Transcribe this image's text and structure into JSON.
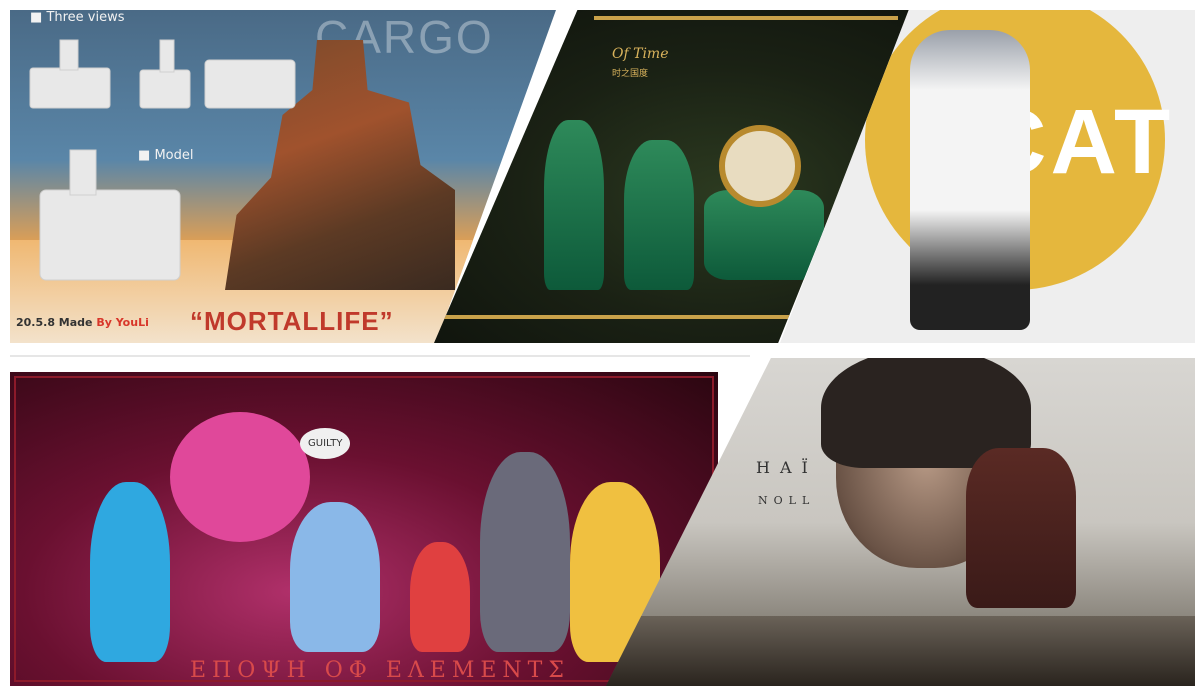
{
  "panels": {
    "mortal_life": {
      "label_three_views": "Three views",
      "label_model": "Model",
      "watermark": "CARGO",
      "made_prefix": "20.5.8 Made ",
      "made_by": "By YouLi",
      "title": "“MORTALLIFE”"
    },
    "of_time": {
      "title": "Of Time",
      "subtitle": "时之国度"
    },
    "cat": {
      "title": "CAT"
    },
    "elements": {
      "bubble": "GUILTY",
      "title": "ΕΠΟΨΗ ΟΦ ΕΛΕΜΕΝΤΣ"
    },
    "dark_fantasy": {
      "title_fragment": "HAÏ",
      "subtitle_fragment": "NOLL"
    }
  },
  "colors": {
    "mortal_title": "#c0392b",
    "gold": "#d9b35c",
    "cat_yellow": "#e5b73d",
    "elements_title": "#d84a4a"
  }
}
